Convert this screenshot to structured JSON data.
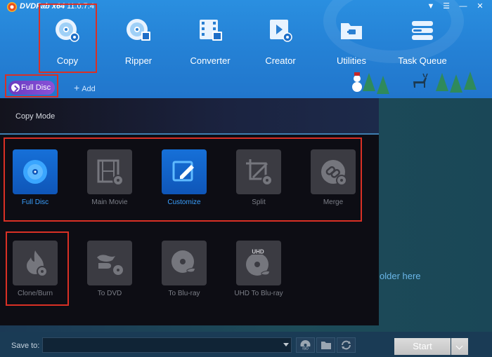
{
  "titlebar": {
    "app_name": "DVDFab x64",
    "version": "11.0.7.4",
    "controls": [
      "pin-icon",
      "menu-icon",
      "minimize-icon",
      "close-icon"
    ]
  },
  "nav": {
    "items": [
      {
        "label": "Copy",
        "icon": "copy-disc-icon",
        "selected": true
      },
      {
        "label": "Ripper",
        "icon": "ripper-disc-icon",
        "selected": false
      },
      {
        "label": "Converter",
        "icon": "converter-film-icon",
        "selected": false
      },
      {
        "label": "Creator",
        "icon": "creator-film-icon",
        "selected": false
      },
      {
        "label": "Utilities",
        "icon": "utilities-folder-icon",
        "selected": false
      },
      {
        "label": "Task Queue",
        "icon": "task-queue-icon",
        "selected": false
      }
    ]
  },
  "subbar": {
    "current_mode": "Full Disc",
    "add_label": "Add"
  },
  "panel": {
    "title": "Copy Mode",
    "modes_row1": [
      {
        "label": "Full Disc",
        "icon": "disc-icon",
        "active": true
      },
      {
        "label": "Main Movie",
        "icon": "film-icon",
        "active": false
      },
      {
        "label": "Customize",
        "icon": "edit-pencil-icon",
        "active": true
      },
      {
        "label": "Split",
        "icon": "crop-split-icon",
        "active": false
      },
      {
        "label": "Merge",
        "icon": "merge-link-icon",
        "active": false
      }
    ],
    "modes_row2": [
      {
        "label": "Clone/Burn",
        "icon": "flame-burn-icon",
        "active": false
      },
      {
        "label": "To DVD",
        "icon": "bluray-to-dvd-icon",
        "active": false
      },
      {
        "label": "To Blu-ray",
        "icon": "to-bluray-icon",
        "active": false
      },
      {
        "label": "UHD To Blu-ray",
        "icon": "uhd-to-bluray-icon",
        "active": false
      }
    ]
  },
  "drop_hint": "older here",
  "bottom": {
    "save_to_label": "Save to:",
    "save_to_value": "",
    "start_label": "Start"
  },
  "colors": {
    "accent": "#2f8fe6",
    "highlight_box": "#d93025",
    "active_label": "#3aa0ff",
    "purple_pill": "#7a46cc"
  }
}
